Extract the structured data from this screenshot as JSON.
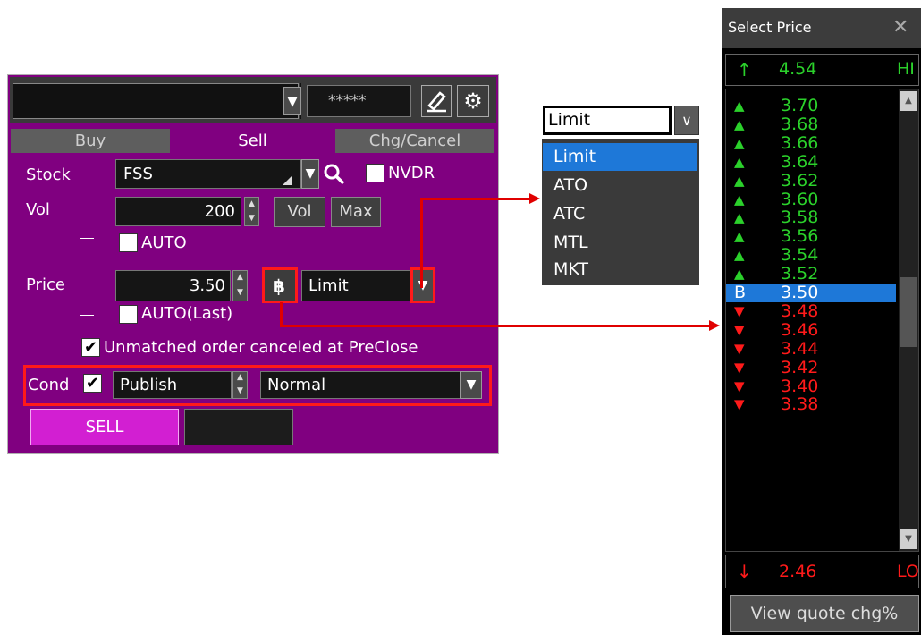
{
  "order_panel": {
    "account_masked": "*****",
    "tabs": [
      "Buy",
      "Sell",
      "Chg/Cancel"
    ],
    "stock_label": "Stock",
    "stock_value": "FSS",
    "nvdr_label": "NVDR",
    "vol_label": "Vol",
    "vol_value": "200",
    "vol_button": "Vol",
    "max_button": "Max",
    "auto_label": "AUTO",
    "price_label": "Price",
    "price_value": "3.50",
    "price_type": "Limit",
    "auto_last_label": "AUTO(Last)",
    "unmatched_label": "Unmatched order canceled at PreClose",
    "cond_label": "Cond",
    "cond_publish": "Publish",
    "cond_normal": "Normal",
    "sell_button": "SELL"
  },
  "order_type_dropdown": {
    "selected": "Limit",
    "options": [
      "Limit",
      "ATO",
      "ATC",
      "MTL",
      "MKT"
    ]
  },
  "select_price": {
    "title": "Select Price",
    "hi_value": "4.54",
    "hi_label": "HI",
    "lo_value": "2.46",
    "lo_label": "LO",
    "up_prices": [
      "3.70",
      "3.68",
      "3.66",
      "3.64",
      "3.62",
      "3.60",
      "3.58",
      "3.56",
      "3.54",
      "3.52"
    ],
    "current_marker": "B",
    "current_price": "3.50",
    "down_prices": [
      "3.48",
      "3.46",
      "3.44",
      "3.42",
      "3.40",
      "3.38"
    ],
    "view_button": "View quote chg%"
  },
  "colors": {
    "panel_bg": "#800080",
    "sell_button": "#d21fd2",
    "up": "#2bd12b",
    "down": "#ff1a1a",
    "selected": "#1e78d8"
  }
}
